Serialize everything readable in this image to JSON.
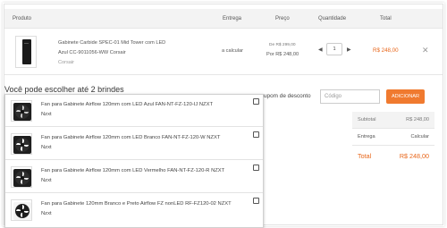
{
  "table_header": {
    "produto": "Produto",
    "entrega": "Entrega",
    "preco": "Preço",
    "quantidade": "Quantidade",
    "total": "Total"
  },
  "product": {
    "name_line1": "Gabinete Carbide SPEC-01 Mid Tower com LED",
    "name_line2": "Azul CC-9011056-WW Corsair",
    "brand": "Corsair",
    "entrega": "a calcular",
    "price_old": "De R$ 299,00",
    "price_new": "Por R$ 248,00",
    "quantity": "1",
    "qty_decrease": "◀",
    "qty_increase": "▶",
    "total": "R$ 248,00",
    "remove": "✕"
  },
  "brindes": {
    "title": "Você pode escolher até 2 brindes",
    "items": [
      {
        "name": "Fan para Gabinete Airflow 120mm com LED Azul FAN-NT-FZ-120-IJ NZXT",
        "brand": "Nzxt"
      },
      {
        "name": "Fan para Gabinete Airflow 120mm com LED Branco FAN-NT-FZ-120-W NZXT",
        "brand": "Nzxt"
      },
      {
        "name": "Fan para Gabinete Airflow 120mm com LED Vermelho FAN-NT-FZ-120-R NZXT",
        "brand": "Nzxt"
      },
      {
        "name": "Fan para Gabinete 120mm Branco e Preto Airflow FZ nonLED RF-FZ120-02 NZXT",
        "brand": "Nzxt"
      }
    ]
  },
  "cupom": {
    "label": "upom de desconto",
    "placeholder": "Código",
    "button": "ADICIONAR"
  },
  "summary": {
    "subtotal_label": "Subtotal",
    "subtotal_value": "R$ 248,00",
    "entrega_label": "Entrega",
    "entrega_value": "Calcular",
    "total_label": "Total",
    "total_value": "R$ 248,00"
  },
  "colors": {
    "accent": "#f07a2f",
    "price": "#e8661a"
  }
}
